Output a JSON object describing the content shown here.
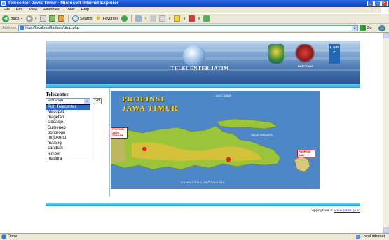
{
  "window": {
    "title": "Telecenter Jawa Timur - Microsoft Internet Explorer",
    "controls": [
      "_",
      "□",
      "×"
    ]
  },
  "menu": [
    "File",
    "Edit",
    "View",
    "Favorites",
    "Tools",
    "Help"
  ],
  "toolbar": {
    "back": "Back",
    "search": "Search",
    "favorites": "Favorites"
  },
  "address": {
    "label": "Address",
    "url": "http://localhost/latihan/drop.php",
    "go": "Go"
  },
  "banner": {
    "title": "TELECENTER JATIM",
    "logo_bappenas": "BAPPENAS",
    "logo_undp": "U N D P"
  },
  "sidebar": {
    "title": "Telecenter",
    "selected": "sidoasjo",
    "go": "Go",
    "options": [
      "Pilih Telecenter",
      "Maospati",
      "magetan",
      "sidoasjo",
      "Sumenep",
      "ponorogo",
      "mojokerto",
      "malang",
      "caruban",
      "jember",
      "madura"
    ],
    "highlighted_index": 0
  },
  "map": {
    "title_line1": "PROPINSI",
    "title_line2": "JAWA TIMUR",
    "sea_north": "LAUT JAWA",
    "strait": "SELAT MADURA",
    "ocean": "SAMUDERA INDONESIA",
    "west_label": "PROPINSI JAWA TENGAH",
    "east_label": "PROPINSI BALI",
    "colors": {
      "sea": "#4e87c8",
      "land": "#9bc43a",
      "highland": "#e6c23a",
      "marker": "#e0201c"
    }
  },
  "footer": {
    "copyright": "Copyrighted ©",
    "link": "www.jatim.go.id"
  },
  "status": {
    "text": "Done",
    "zone": "Local intranet"
  },
  "theme": {
    "titlebar": "#0a3fc0",
    "chrome": "#ece9d8",
    "accent_bar": "#1a9fd8"
  }
}
